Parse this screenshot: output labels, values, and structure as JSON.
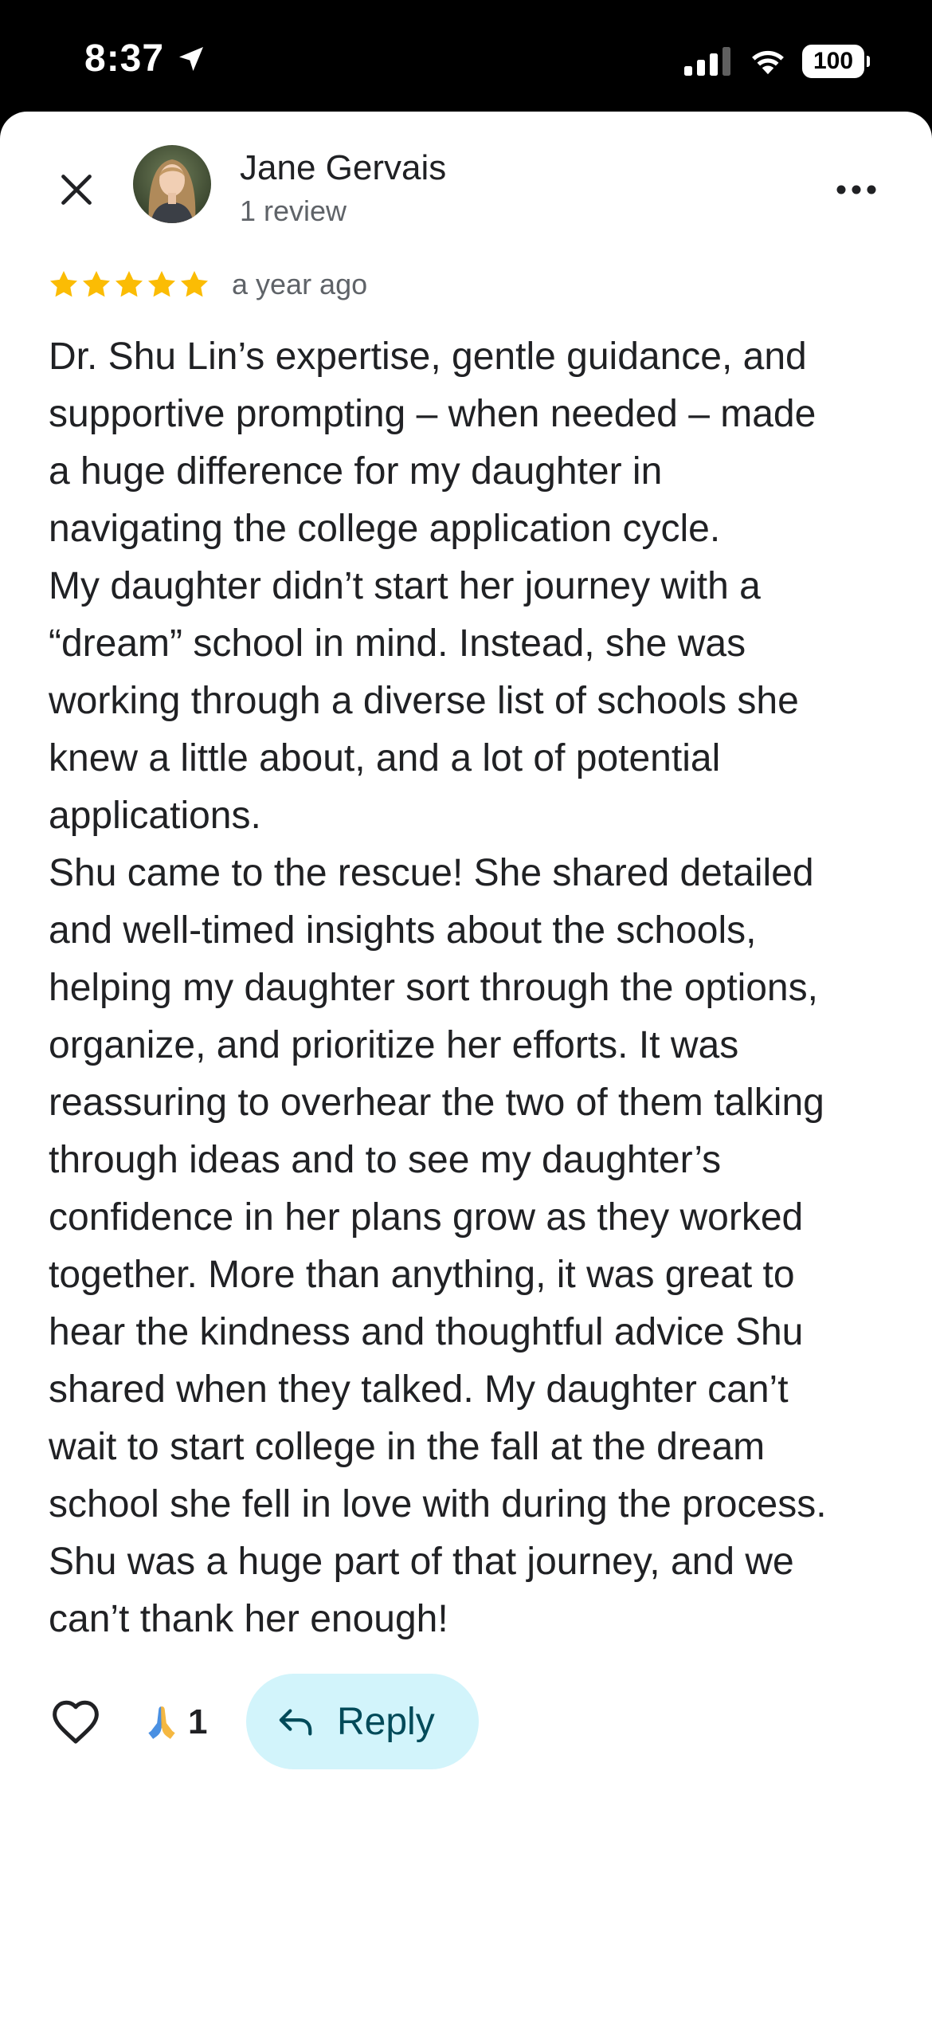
{
  "status_bar": {
    "time": "8:37",
    "battery": "100"
  },
  "icons": {
    "location": "location-arrow-icon",
    "signal": "cellular-signal-icon",
    "wifi": "wifi-icon",
    "battery": "battery-icon",
    "close": "close-icon",
    "more": "more-horizontal-icon",
    "star": "star-icon",
    "like": "heart-outline-icon",
    "reaction": "folded-hands-icon",
    "reply": "reply-arrow-icon"
  },
  "colors": {
    "star": "#FBBC04",
    "reply_bg": "#D2F4FB",
    "reply_text": "#004A59",
    "text_primary": "#202124",
    "text_secondary": "#5F6368"
  },
  "author": {
    "name": "Jane Gervais",
    "review_count": "1 review"
  },
  "review": {
    "rating": 5,
    "time_ago": "a year ago",
    "lines": [
      "Dr. Shu Lin’s expertise, gentle guidance, and",
      "supportive prompting – when needed – made",
      "a huge difference for my daughter in",
      "navigating the college application cycle.",
      "My daughter didn’t start her journey with a",
      "“dream” school in mind. Instead, she was",
      "working through a diverse list of schools she",
      "knew a little about, and a lot of potential",
      "applications.",
      "Shu came to the rescue! She shared detailed",
      "and well-timed insights about the schools,",
      "helping my daughter sort through the options,",
      "organize, and prioritize her efforts. It was",
      "reassuring to overhear the two of them talking",
      "through ideas and to see my daughter’s",
      "confidence in her plans grow as they worked",
      "together. More than anything, it was great to",
      "hear the kindness and thoughtful advice Shu",
      "shared when they talked. My daughter can’t",
      "wait to start college in the fall at the dream",
      "school she fell in love with during the process.",
      "Shu was a huge part of that journey, and we",
      "can’t thank her enough!"
    ]
  },
  "actions": {
    "reaction_count": "1",
    "reply_label": "Reply"
  }
}
